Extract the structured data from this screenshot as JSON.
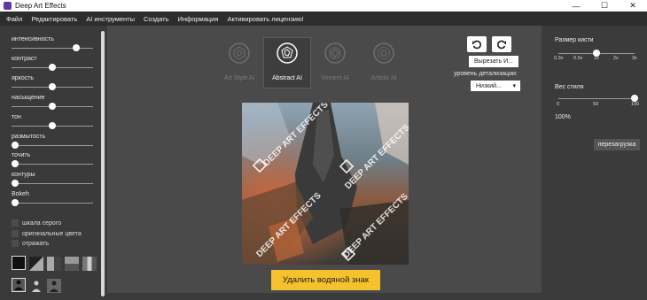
{
  "window": {
    "title": "Deep Art Effects",
    "minimize": "—",
    "maximize": "☐",
    "close": "✕"
  },
  "menu": [
    "Файл",
    "Редактировать",
    "AI инструменты",
    "Создать",
    "Информация",
    "Активировать лицензию!"
  ],
  "left_panel": {
    "sliders": [
      {
        "label": "интенсивность",
        "value": 0.82
      },
      {
        "label": "контраст",
        "value": 0.5
      },
      {
        "label": "яркость",
        "value": 0.5
      },
      {
        "label": "насыщение",
        "value": 0.5
      },
      {
        "label": "тон",
        "value": 0.5
      },
      {
        "label": "размытость",
        "value": 0.0
      },
      {
        "label": "точить",
        "value": 0.0
      },
      {
        "label": "контуры",
        "value": 0.0
      },
      {
        "label": "Bokeh",
        "value": 0.0
      }
    ],
    "checkboxes": [
      {
        "label": "шкала серого",
        "checked": false
      },
      {
        "label": "оригинальные цвета",
        "checked": false
      },
      {
        "label": "отражать",
        "checked": false
      }
    ]
  },
  "styles": [
    {
      "name": "Art Style AI",
      "selected": false
    },
    {
      "name": "Abstract AI",
      "selected": true
    },
    {
      "name": "Vincent AI",
      "selected": false
    },
    {
      "name": "Artistic AI",
      "selected": false
    }
  ],
  "toolbar": {
    "undo_icon": "undo-icon",
    "redo_icon": "redo-icon",
    "cut_label": "Вырезать И...",
    "detail_label": "уровень детализации:",
    "detail_value": "Низкий...",
    "detail_arrow": "▾"
  },
  "remove_watermark": "Удалить водяной знак",
  "right_panel": {
    "brush_label": "Размер кисти",
    "brush_ticks": [
      "0.3x",
      "0.5x",
      "1x",
      "2x",
      "3x"
    ],
    "brush_value": 0.5,
    "weight_label": "Вес стиля",
    "weight_ticks": [
      "0",
      "50",
      "100"
    ],
    "weight_value": 1.0,
    "weight_percent": "100%",
    "reload_label": "перезагрузка"
  },
  "canvas": {
    "watermark_text": "DEEP ART EFFECTS"
  },
  "colors": {
    "accent": "#f5c12c",
    "bg": "#3b3b3b",
    "center_bg": "#4a4a4a"
  }
}
